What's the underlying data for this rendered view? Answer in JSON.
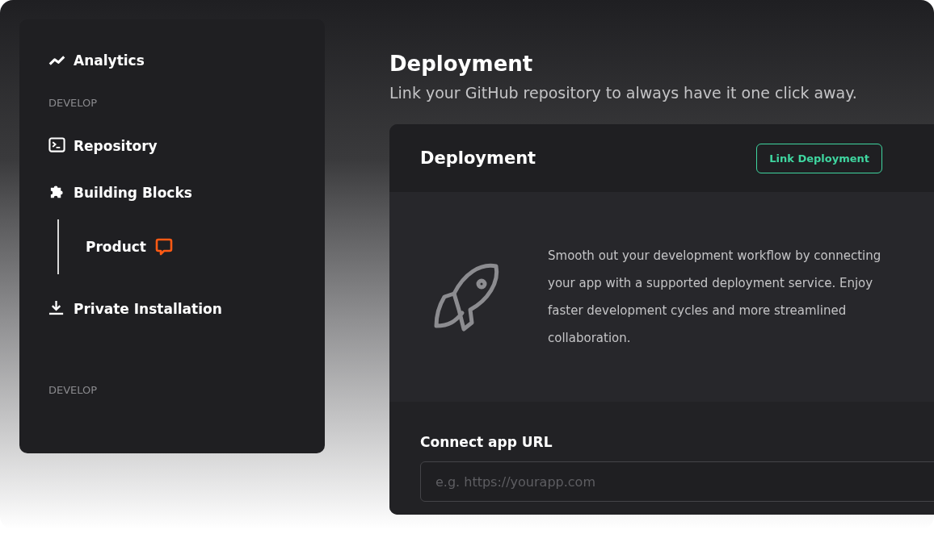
{
  "sidebar": {
    "items": [
      {
        "kind": "link",
        "label": "Analytics"
      },
      {
        "kind": "section",
        "label": "DEVELOP"
      },
      {
        "kind": "link",
        "label": "Repository"
      },
      {
        "kind": "link",
        "label": "Building Blocks",
        "children": [
          {
            "label": "Product",
            "badge": true
          }
        ]
      },
      {
        "kind": "link",
        "label": "Private Installation"
      },
      {
        "kind": "section",
        "label": "DEVELOP"
      }
    ]
  },
  "header": {
    "title": "Deployment",
    "subtitle": "Link your GitHub repository to always have it one click away."
  },
  "card": {
    "title": "Deployment",
    "button": "Link Deployment",
    "description": "Smooth out your development workflow by connecting your app with a supported deployment service. Enjoy faster development cycles and more streamlined collaboration.",
    "field_label": "Connect app URL",
    "placeholder": "e.g. https://yourapp.com"
  }
}
